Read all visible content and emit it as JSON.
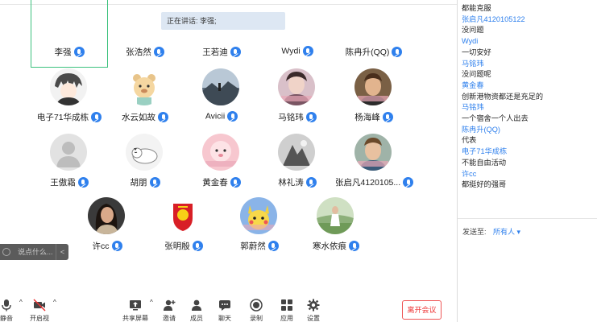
{
  "banner": {
    "speaking": "正在讲话: 李强;"
  },
  "participants": [
    {
      "name": "李强",
      "avatar": "none",
      "active": true
    },
    {
      "name": "张浩然",
      "avatar": "none"
    },
    {
      "name": "王若迪",
      "avatar": "none"
    },
    {
      "name": "Wydi",
      "avatar": "none"
    },
    {
      "name": "陈冉升(QQ)",
      "avatar": "none"
    },
    {
      "name": "电子71华成栋",
      "avatar": "anime-boy"
    },
    {
      "name": "水云如故",
      "avatar": "cartoon-bear"
    },
    {
      "name": "Avicii",
      "avatar": "landscape"
    },
    {
      "name": "马铭玮",
      "avatar": "portrait-pink"
    },
    {
      "name": "杨海峰",
      "avatar": "portrait-man"
    },
    {
      "name": "王傲霜",
      "avatar": "default-user"
    },
    {
      "name": "胡朋",
      "avatar": "sleeping-cat"
    },
    {
      "name": "黄金春",
      "avatar": "pink-cartoon"
    },
    {
      "name": "林礼涛",
      "avatar": "monochrome"
    },
    {
      "name": "张启凡4120105...",
      "avatar": "young-man"
    },
    {
      "name": "许cc",
      "avatar": "girl-dark"
    },
    {
      "name": "张明殷",
      "avatar": "club-badge"
    },
    {
      "name": "郭蔚然",
      "avatar": "pikachu"
    },
    {
      "name": "寒水依痕",
      "avatar": "girl-field"
    }
  ],
  "chat_input": {
    "placeholder": "说点什么...",
    "collapse": "<"
  },
  "toolbar": {
    "mute": "静音",
    "video": "开启视频",
    "share": "共享屏幕",
    "invite": "邀请",
    "members": "成员(19)",
    "chat": "聊天",
    "record": "录制",
    "apps": "应用",
    "settings": "设置",
    "leave": "离开会议"
  },
  "chat": {
    "messages": [
      {
        "kind": "text",
        "text": "都能克服"
      },
      {
        "kind": "sender",
        "text": "张启凡4120105122"
      },
      {
        "kind": "text",
        "text": "没问题"
      },
      {
        "kind": "sender",
        "text": "Wydi"
      },
      {
        "kind": "text",
        "text": "一切安好"
      },
      {
        "kind": "sender",
        "text": "马铭玮"
      },
      {
        "kind": "text",
        "text": "没问题呢"
      },
      {
        "kind": "sender",
        "text": "黄金春"
      },
      {
        "kind": "text",
        "text": "创新港物资都还是充足的"
      },
      {
        "kind": "sender",
        "text": "马铭玮"
      },
      {
        "kind": "text",
        "text": "一个宿舍一个人出去"
      },
      {
        "kind": "sender",
        "text": "陈冉升(QQ)"
      },
      {
        "kind": "text",
        "text": "代表"
      },
      {
        "kind": "sender",
        "text": "电子71华成栋"
      },
      {
        "kind": "text",
        "text": "不能自由活动"
      },
      {
        "kind": "sender",
        "text": "许cc"
      },
      {
        "kind": "text",
        "text": "都挺好的强哥"
      }
    ],
    "send_to_label": "发送至:",
    "send_to_value": "所有人 ▾"
  },
  "colors": {
    "accent": "#2f80ed",
    "active_border": "#3cc27d",
    "leave": "#e33333"
  }
}
